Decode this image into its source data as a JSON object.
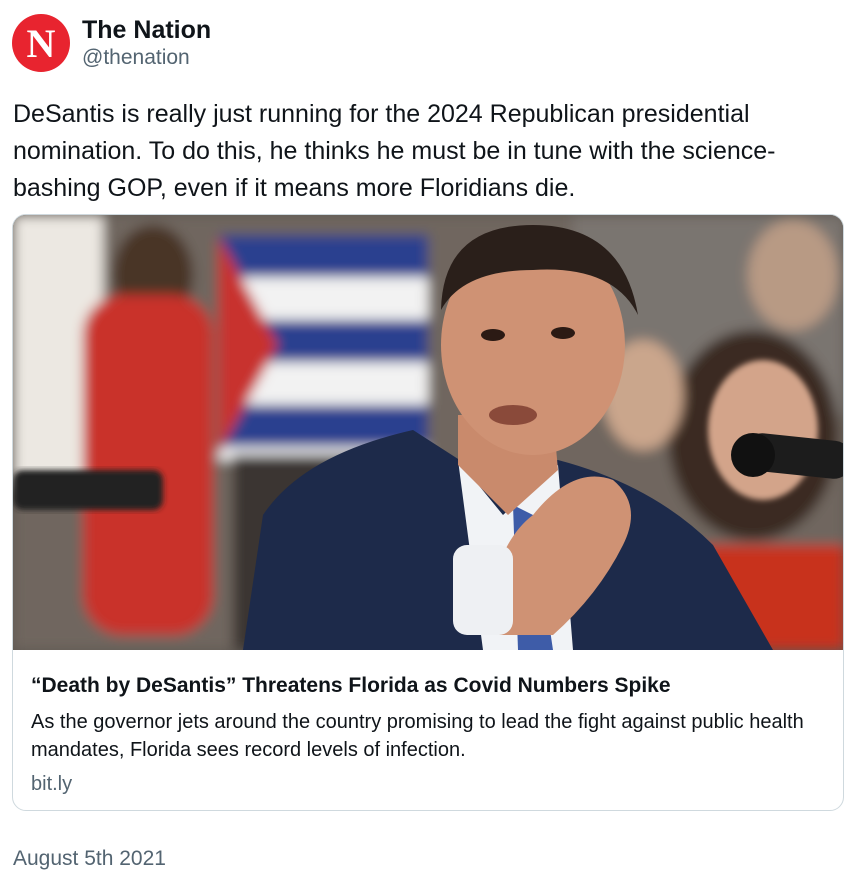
{
  "author": {
    "display_name": "The Nation",
    "handle": "@thenation",
    "avatar_letter": "N",
    "avatar_color": "#e8242f"
  },
  "tweet": {
    "text": "DeSantis is really just running for the 2024 Republican presidential nomination. To do this, he thinks he must be in tune with the science-bashing GOP, even if it means more Floridians die."
  },
  "card": {
    "title": "“Death by DeSantis” Threatens Florida as Covid Numbers Spike",
    "description": "As the governor jets around the country promising to lead the fight against public health mandates, Florida sees record levels of infection.",
    "domain": "bit.ly"
  },
  "timestamp": "August 5th 2021"
}
